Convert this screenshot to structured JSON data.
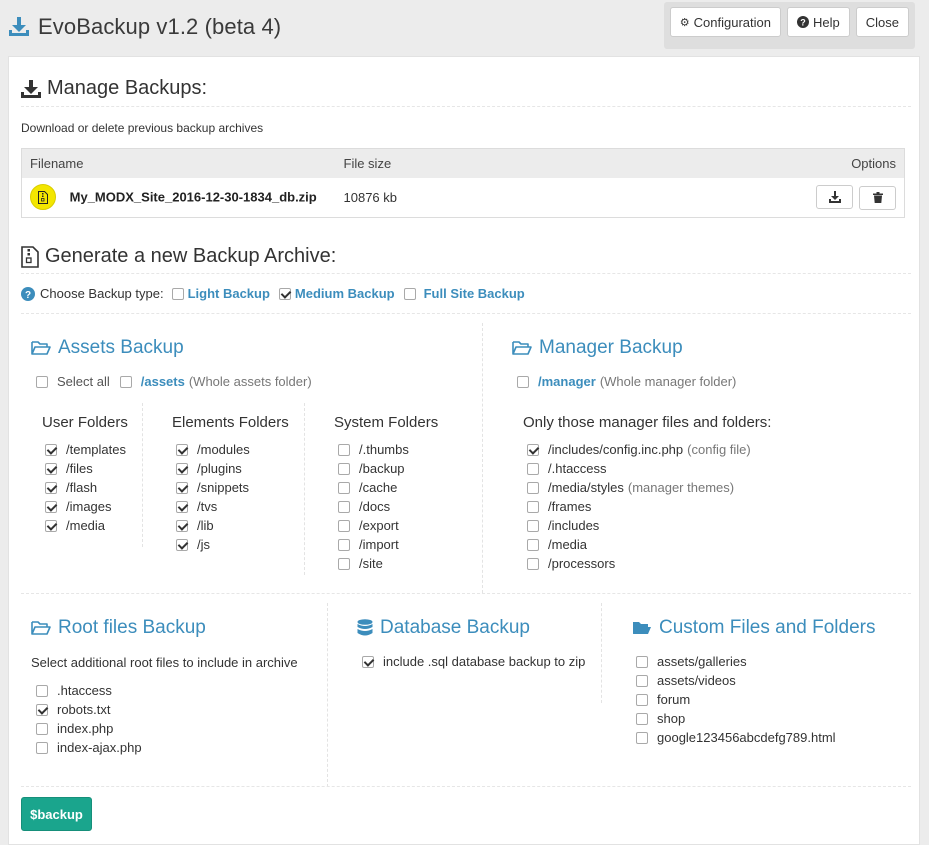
{
  "app": {
    "title": "EvoBackup v1.2 (beta 4)"
  },
  "toolbar": {
    "configuration": "Configuration",
    "help": "Help",
    "close": "Close"
  },
  "manage": {
    "title": "Manage Backups:",
    "description": "Download or delete previous backup archives",
    "columns": {
      "filename": "Filename",
      "filesize": "File size",
      "options": "Options"
    },
    "files": [
      {
        "name": "My_MODX_Site_2016-12-30-1834_db.zip",
        "size": "10876 kb"
      }
    ]
  },
  "generate": {
    "title": "Generate a new Backup Archive:",
    "choose_label": "Choose Backup type:",
    "types": [
      {
        "label": "Light Backup",
        "checked": false
      },
      {
        "label": "Medium Backup",
        "checked": true
      },
      {
        "label": "Full Site Backup",
        "checked": false
      }
    ]
  },
  "assets": {
    "title": "Assets Backup",
    "select_all": "Select all",
    "assets_path": "/assets",
    "assets_note": "(Whole assets folder)",
    "user_folders": {
      "title": "User Folders",
      "items": [
        {
          "label": "/templates",
          "checked": true
        },
        {
          "label": "/files",
          "checked": true
        },
        {
          "label": "/flash",
          "checked": true
        },
        {
          "label": "/images",
          "checked": true
        },
        {
          "label": "/media",
          "checked": true
        }
      ]
    },
    "elements_folders": {
      "title": "Elements Folders",
      "items": [
        {
          "label": "/modules",
          "checked": true
        },
        {
          "label": "/plugins",
          "checked": true
        },
        {
          "label": "/snippets",
          "checked": true
        },
        {
          "label": "/tvs",
          "checked": true
        },
        {
          "label": "/lib",
          "checked": true
        },
        {
          "label": "/js",
          "checked": true
        }
      ]
    },
    "system_folders": {
      "title": "System Folders",
      "items": [
        {
          "label": "/.thumbs",
          "checked": false
        },
        {
          "label": "/backup",
          "checked": false
        },
        {
          "label": "/cache",
          "checked": false
        },
        {
          "label": "/docs",
          "checked": false
        },
        {
          "label": "/export",
          "checked": false
        },
        {
          "label": "/import",
          "checked": false
        },
        {
          "label": "/site",
          "checked": false
        }
      ]
    }
  },
  "manager": {
    "title": "Manager Backup",
    "manager_path": "/manager",
    "manager_note": "(Whole manager folder)",
    "subtitle": "Only those manager files and folders:",
    "items": [
      {
        "label": "/includes/config.inc.php",
        "note": "(config file)",
        "checked": true
      },
      {
        "label": "/.htaccess",
        "note": "",
        "checked": false
      },
      {
        "label": "/media/styles",
        "note": "(manager themes)",
        "checked": false
      },
      {
        "label": "/frames",
        "note": "",
        "checked": false
      },
      {
        "label": "/includes",
        "note": "",
        "checked": false
      },
      {
        "label": "/media",
        "note": "",
        "checked": false
      },
      {
        "label": "/processors",
        "note": "",
        "checked": false
      }
    ]
  },
  "root": {
    "title": "Root files Backup",
    "description": "Select additional root files to include in archive",
    "items": [
      {
        "label": ".htaccess",
        "checked": false
      },
      {
        "label": "robots.txt",
        "checked": true
      },
      {
        "label": "index.php",
        "checked": false
      },
      {
        "label": "index-ajax.php",
        "checked": false
      }
    ]
  },
  "database": {
    "title": "Database Backup",
    "items": [
      {
        "label": "include .sql database backup to zip",
        "checked": true
      }
    ]
  },
  "custom": {
    "title": "Custom Files and Folders",
    "items": [
      {
        "label": "assets/galleries",
        "checked": false
      },
      {
        "label": "assets/videos",
        "checked": false
      },
      {
        "label": "forum",
        "checked": false
      },
      {
        "label": "shop",
        "checked": false
      },
      {
        "label": "google123456abcdefg789.html",
        "checked": false
      }
    ]
  },
  "submit": {
    "label": "$backup"
  },
  "colors": {
    "accent": "#3c8dbc",
    "submit": "#1aa58d",
    "zip_badge": "#f3e600"
  }
}
